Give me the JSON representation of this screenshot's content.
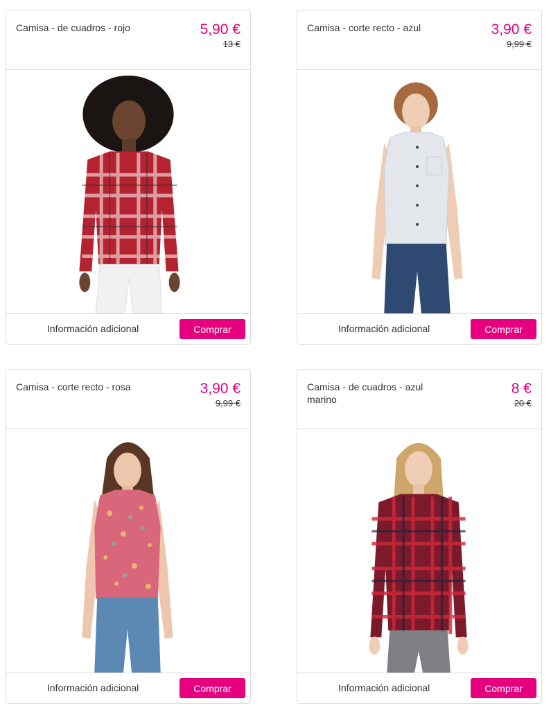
{
  "products": [
    {
      "title": "Camisa - de cuadros - rojo",
      "price": "5,90 €",
      "old_price": "13 €",
      "info_label": "Información adicional",
      "buy_label": "Comprar",
      "image": "woman-red-plaid-shirt"
    },
    {
      "title": "Camisa - corte recto - azul",
      "price": "3,90 €",
      "old_price": "9,99 €",
      "info_label": "Información adicional",
      "buy_label": "Comprar",
      "image": "woman-light-blue-sleeveless-shirt"
    },
    {
      "title": "Camisa - corte recto - rosa",
      "price": "3,90 €",
      "old_price": "9,99 €",
      "info_label": "Información adicional",
      "buy_label": "Comprar",
      "image": "woman-pink-floral-sleeveless-shirt"
    },
    {
      "title": "Camisa - de cuadros - azul marino",
      "price": "8 €",
      "old_price": "20 €",
      "info_label": "Información adicional",
      "buy_label": "Comprar",
      "image": "woman-navy-red-plaid-shirt"
    }
  ],
  "colors": {
    "accent": "#e6007e",
    "border": "#dcdcdc",
    "text": "#333333"
  }
}
